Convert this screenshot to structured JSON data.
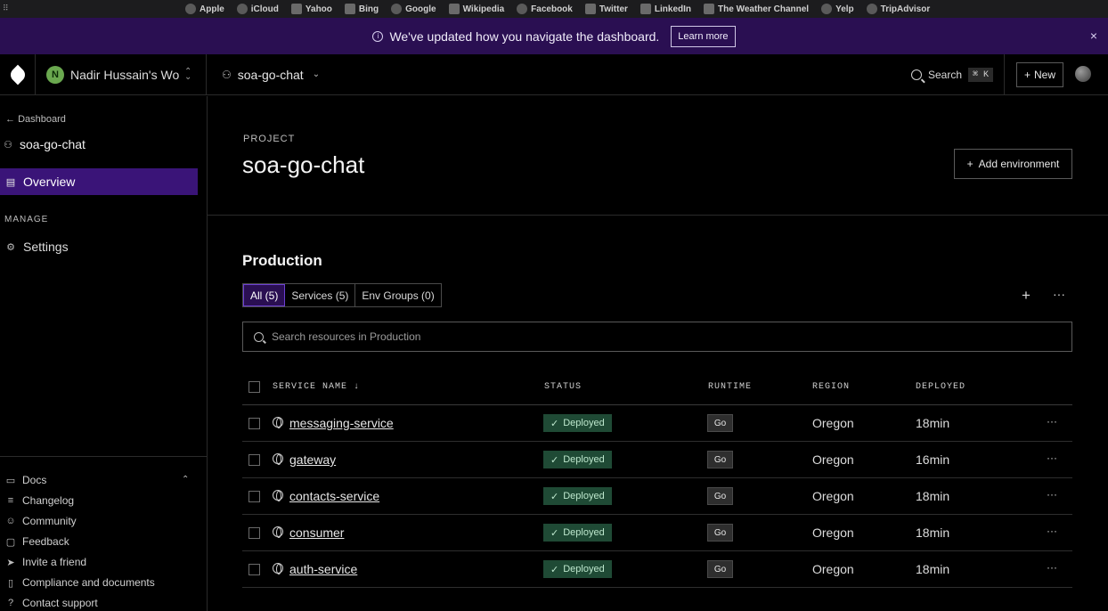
{
  "bookmarks": [
    "Apple",
    "iCloud",
    "Yahoo",
    "Bing",
    "Google",
    "Wikipedia",
    "Facebook",
    "Twitter",
    "LinkedIn",
    "The Weather Channel",
    "Yelp",
    "TripAdvisor"
  ],
  "banner": {
    "message": "We've updated how you navigate the dashboard.",
    "learn_more": "Learn more",
    "close": "×"
  },
  "header": {
    "workspace_initial": "N",
    "workspace_name": "Nadir Hussain's Wo...",
    "project_name": "soa-go-chat",
    "search_label": "Search",
    "search_shortcut": "⌘ K",
    "new_label": "New"
  },
  "sidebar": {
    "back_label": "Dashboard",
    "project_name": "soa-go-chat",
    "overview_label": "Overview",
    "manage_heading": "MANAGE",
    "settings_label": "Settings",
    "links": [
      "Docs",
      "Changelog",
      "Community",
      "Feedback",
      "Invite a friend",
      "Compliance and documents",
      "Contact support"
    ]
  },
  "main": {
    "label": "PROJECT",
    "title": "soa-go-chat",
    "add_environment": "Add environment",
    "section_title": "Production",
    "tabs": [
      "All (5)",
      "Services (5)",
      "Env Groups (0)"
    ],
    "search_placeholder": "Search resources in Production",
    "columns": [
      "SERVICE NAME",
      "STATUS",
      "RUNTIME",
      "REGION",
      "DEPLOYED"
    ],
    "rows": [
      {
        "name": "messaging-service",
        "status": "Deployed",
        "runtime": "Go",
        "region": "Oregon",
        "deployed": "18min"
      },
      {
        "name": "gateway",
        "status": "Deployed",
        "runtime": "Go",
        "region": "Oregon",
        "deployed": "16min"
      },
      {
        "name": "contacts-service",
        "status": "Deployed",
        "runtime": "Go",
        "region": "Oregon",
        "deployed": "18min"
      },
      {
        "name": "consumer",
        "status": "Deployed",
        "runtime": "Go",
        "region": "Oregon",
        "deployed": "18min"
      },
      {
        "name": "auth-service",
        "status": "Deployed",
        "runtime": "Go",
        "region": "Oregon",
        "deployed": "18min"
      }
    ]
  },
  "colors": {
    "banner_bg": "#2a0f52",
    "active_nav": "#3a1478",
    "deployed_bg": "#1f4a35"
  }
}
